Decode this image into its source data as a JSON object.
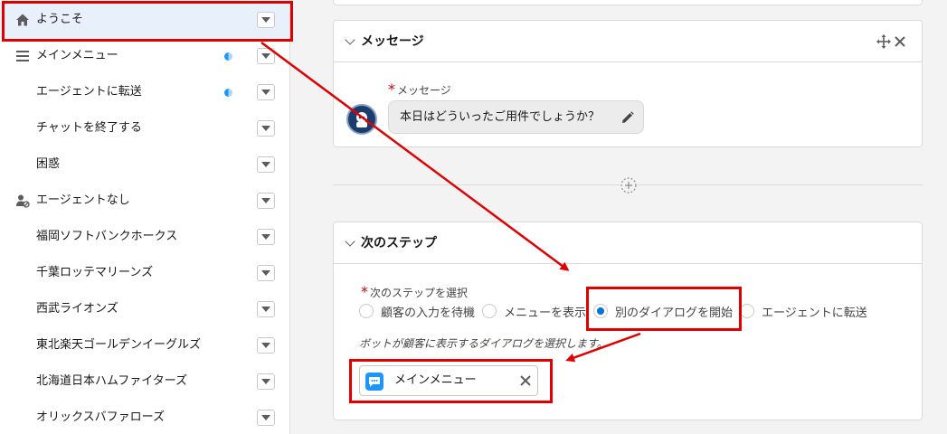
{
  "sidebar": {
    "items": [
      {
        "label": "ようこそ",
        "icon": "home-icon",
        "active": true,
        "dot": false
      },
      {
        "label": "メインメニュー",
        "icon": "menu-icon",
        "active": false,
        "dot": true
      },
      {
        "label": "エージェントに転送",
        "icon": "",
        "active": false,
        "dot": true
      },
      {
        "label": "チャットを終了する",
        "icon": "",
        "active": false,
        "dot": false
      },
      {
        "label": "困惑",
        "icon": "",
        "active": false,
        "dot": false
      },
      {
        "label": "エージェントなし",
        "icon": "agent-off-icon",
        "active": false,
        "dot": false
      },
      {
        "label": "福岡ソフトバンクホークス",
        "icon": "",
        "active": false,
        "dot": false
      },
      {
        "label": "千葉ロッテマリーンズ",
        "icon": "",
        "active": false,
        "dot": false
      },
      {
        "label": "西武ライオンズ",
        "icon": "",
        "active": false,
        "dot": false
      },
      {
        "label": "東北楽天ゴールデンイーグルズ",
        "icon": "",
        "active": false,
        "dot": false
      },
      {
        "label": "北海道日本ハムファイターズ",
        "icon": "",
        "active": false,
        "dot": false
      },
      {
        "label": "オリックスバファローズ",
        "icon": "",
        "active": false,
        "dot": false
      }
    ]
  },
  "message_card": {
    "title": "メッセージ",
    "field_required": "*",
    "field_label": "メッセージ",
    "bubble_text": "本日はどういったご用件でしょうか？"
  },
  "next_step_card": {
    "title": "次のステップ",
    "field_required": "*",
    "field_label": "次のステップを選択",
    "options": [
      {
        "label": "顧客の入力を待機",
        "selected": false
      },
      {
        "label": "メニューを表示",
        "selected": false
      },
      {
        "label": "別のダイアログを開始",
        "selected": true
      },
      {
        "label": "エージェントに転送",
        "selected": false
      }
    ],
    "help_text": "ボットが顧客に表示するダイアログを選択します。",
    "selected_dialog": "メインメニュー"
  },
  "colors": {
    "annotation": "#e00000",
    "accent": "#0176d3",
    "bot_avatar": "#1b3d6e",
    "chip_icon": "#1b96ff"
  }
}
